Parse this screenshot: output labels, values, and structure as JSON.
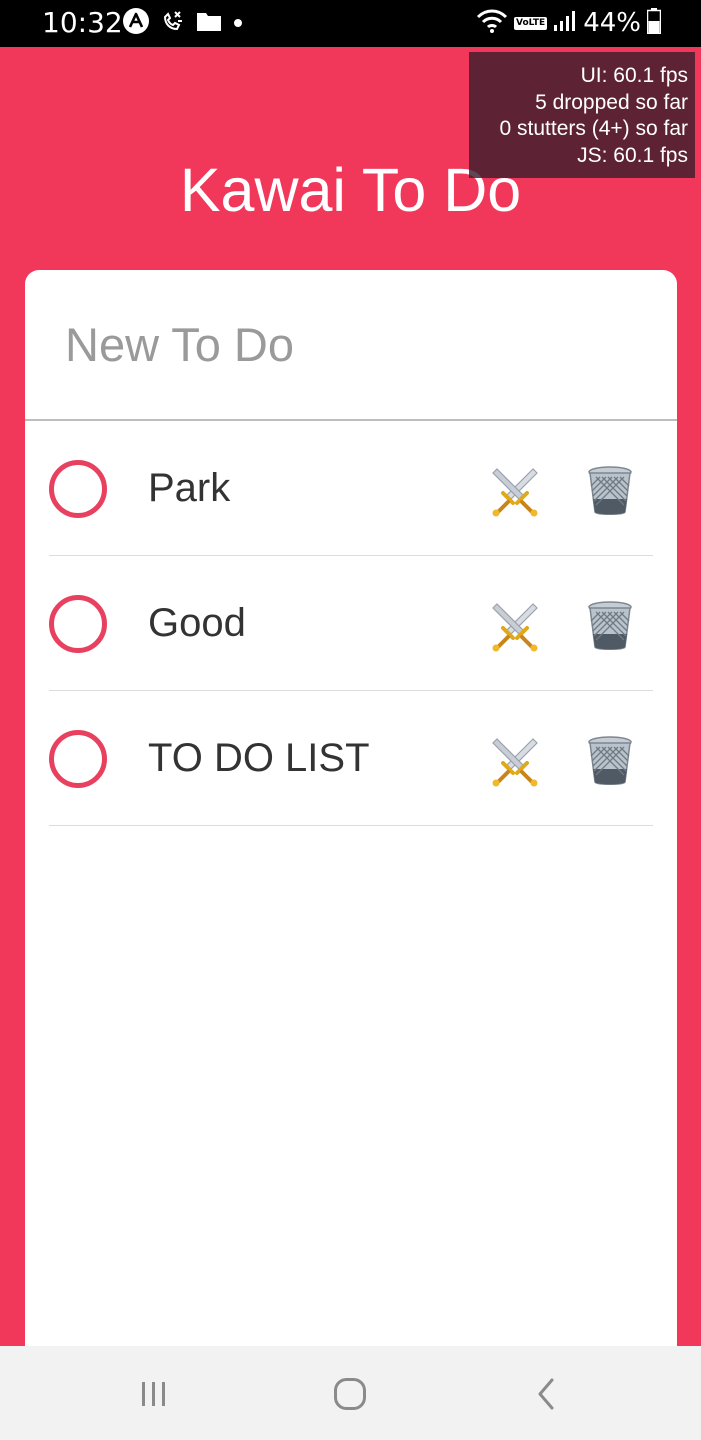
{
  "status_bar": {
    "time": "10:32",
    "battery_percent": "44%",
    "volte_label": "VoLTE",
    "left_icons": [
      "expo-icon",
      "missed-call-icon",
      "folder-icon",
      "dot-icon"
    ],
    "right_icons": [
      "wifi-icon",
      "volte-icon",
      "signal-icon",
      "battery-icon"
    ]
  },
  "perf_monitor": {
    "ui_fps": "UI: 60.1 fps",
    "dropped": "5 dropped so far",
    "stutters": "0 stutters (4+) so far",
    "js_fps": "JS: 60.1 fps"
  },
  "header": {
    "title": "Kawai To Do"
  },
  "new_todo": {
    "placeholder": "New To Do",
    "value": ""
  },
  "todos": [
    {
      "text": "Park",
      "completed": false
    },
    {
      "text": "Good",
      "completed": false
    },
    {
      "text": "TO DO LIST",
      "completed": false
    }
  ],
  "colors": {
    "background": "#f2385a",
    "checkbox": "#e8405f",
    "card": "#ffffff",
    "text": "#333333",
    "placeholder": "#9a9a9a"
  },
  "item_icons": {
    "edit": "crossed-swords-icon",
    "delete": "wastebasket-icon"
  },
  "nav_bar": {
    "buttons": [
      "recent-apps-icon",
      "home-icon",
      "back-icon"
    ]
  }
}
